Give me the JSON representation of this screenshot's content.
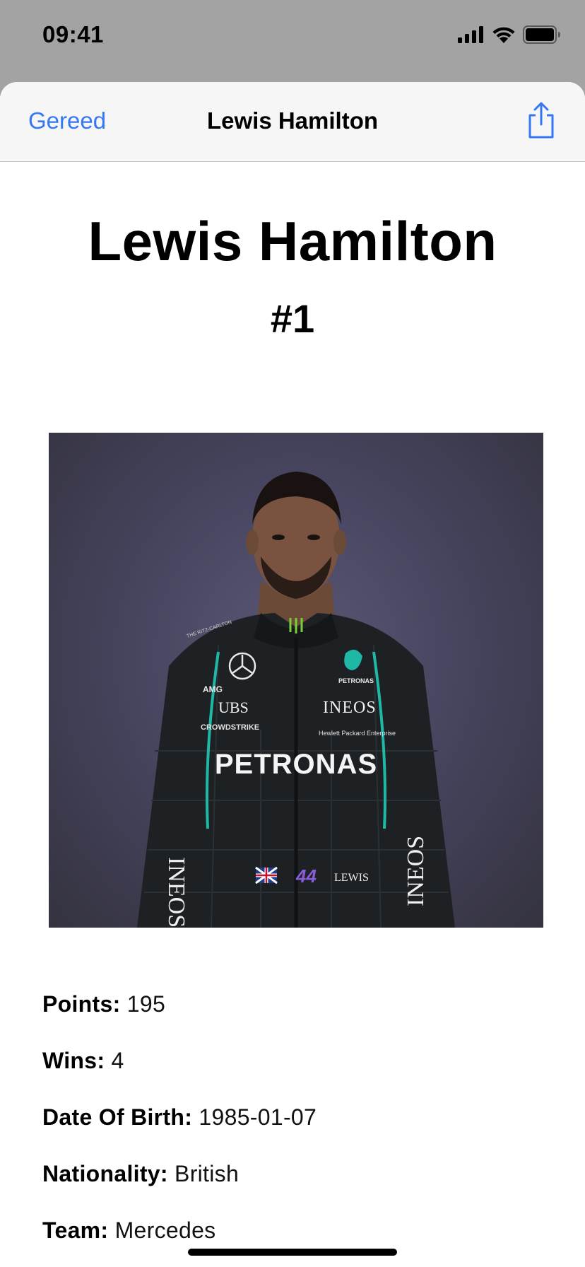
{
  "status_bar": {
    "time": "09:41"
  },
  "nav": {
    "done_label": "Gereed",
    "title": "Lewis Hamilton"
  },
  "driver": {
    "name": "Lewis Hamilton",
    "number": "#1",
    "photo_description": "Driver portrait in racing suit"
  },
  "stats": [
    {
      "label": "Points:",
      "value": "195"
    },
    {
      "label": "Wins:",
      "value": "4"
    },
    {
      "label": "Date Of Birth:",
      "value": "1985-01-07"
    },
    {
      "label": "Nationality:",
      "value": "British"
    },
    {
      "label": "Team:",
      "value": "Mercedes"
    }
  ],
  "suit_text": {
    "sponsor_main": "PETRONAS",
    "sponsor_2": "INEOS",
    "sponsor_3": "UBS",
    "sponsor_4": "CROWDSTRIKE",
    "sponsor_5": "Hewlett Packard Enterprise",
    "sponsor_6": "AMG",
    "sponsor_7": "PETRONAS",
    "sponsor_8": "THE RITZ-CARLTON",
    "car_number": "44",
    "driver_tag": "LEWIS"
  },
  "colors": {
    "accent": "#3478f6",
    "status_bg": "#a3a3a3",
    "nav_bg": "#f6f6f6"
  }
}
